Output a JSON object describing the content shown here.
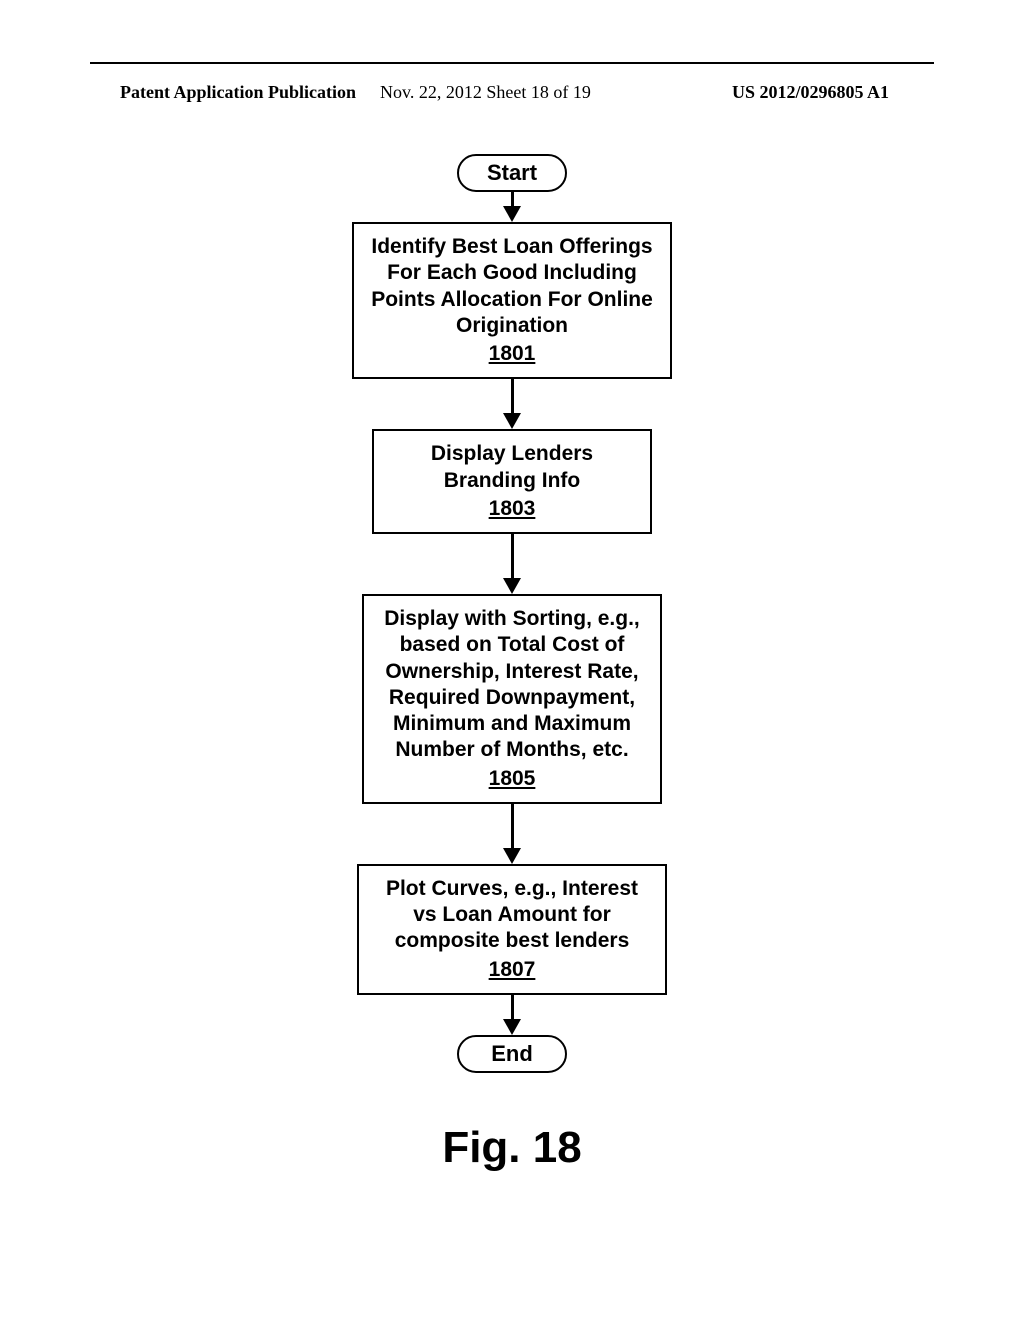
{
  "header": {
    "left": "Patent Application Publication",
    "center": "Nov. 22, 2012  Sheet 18 of 19",
    "right": "US 2012/0296805 A1"
  },
  "flowchart": {
    "start": "Start",
    "box1": {
      "text": "Identify Best Loan Offerings For Each Good Including Points Allocation For Online Origination",
      "ref": "1801"
    },
    "box2": {
      "text": "Display Lenders Branding Info",
      "ref": "1803"
    },
    "box3": {
      "text": "Display with Sorting, e.g., based on Total Cost of Ownership, Interest Rate, Required Downpayment, Minimum and Maximum Number of Months, etc.",
      "ref": "1805"
    },
    "box4": {
      "text": "Plot Curves, e.g., Interest vs Loan Amount for composite best lenders",
      "ref": "1807"
    },
    "end": "End"
  },
  "figure_label": "Fig. 18"
}
